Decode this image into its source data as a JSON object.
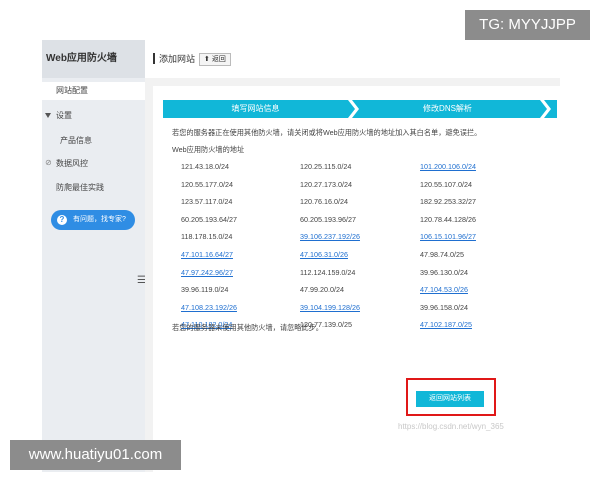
{
  "watermark_top": "TG: MYYJJPP",
  "watermark_bottom": "www.huatiyu01.com",
  "watermark_url": "https://blog.csdn.net/wyn_365",
  "sidebar": {
    "title": "Web应用防火墙",
    "items": [
      "网站配置",
      "设置",
      "产品信息",
      "数据风控",
      "防爬最佳实践"
    ],
    "help": "有问题，找专家?"
  },
  "header": {
    "title": "添加网站",
    "back_label": "返回"
  },
  "steps": [
    "填写网站信息",
    "修改DNS解析"
  ],
  "intro": "若您的服务器正在使用其他防火墙，请关闭或将Web应用防火墙的地址加入其白名单，避免误拦。",
  "subheading": "Web应用防火墙的地址",
  "ip_rows": [
    [
      "121.43.18.0/24",
      "120.25.115.0/24",
      "101.200.106.0/24"
    ],
    [
      "120.55.177.0/24",
      "120.27.173.0/24",
      "120.55.107.0/24"
    ],
    [
      "123.57.117.0/24",
      "120.76.16.0/24",
      "182.92.253.32/27"
    ],
    [
      "60.205.193.64/27",
      "60.205.193.96/27",
      "120.78.44.128/26"
    ],
    [
      "118.178.15.0/24",
      "39.106.237.192/26",
      "106.15.101.96/27"
    ],
    [
      "47.101.16.64/27",
      "47.106.31.0/26",
      "47.98.74.0/25"
    ],
    [
      "47.97.242.96/27",
      "112.124.159.0/24",
      "39.96.130.0/24"
    ],
    [
      "39.96.119.0/24",
      "47.99.20.0/24",
      "47.104.53.0/26"
    ],
    [
      "47.108.23.192/26",
      "39.104.199.128/26",
      "39.96.158.0/24"
    ],
    [
      "47.110.182.0/24",
      "120.77.139.0/25",
      "47.102.187.0/25"
    ]
  ],
  "ip_links": [
    [
      false,
      false,
      true
    ],
    [
      false,
      false,
      false
    ],
    [
      false,
      false,
      false
    ],
    [
      false,
      false,
      false
    ],
    [
      false,
      true,
      true
    ],
    [
      true,
      true,
      false
    ],
    [
      true,
      false,
      false
    ],
    [
      false,
      false,
      true
    ],
    [
      true,
      true,
      false
    ],
    [
      true,
      false,
      true
    ]
  ],
  "footer_note": "若您的服务器未使用其他防火墙，请忽略此步。",
  "return_label": "返回网站列表",
  "colors": {
    "accent": "#11b7d8",
    "highlight": "#e01818",
    "link": "#1f6fd0",
    "help": "#2f8de4"
  }
}
